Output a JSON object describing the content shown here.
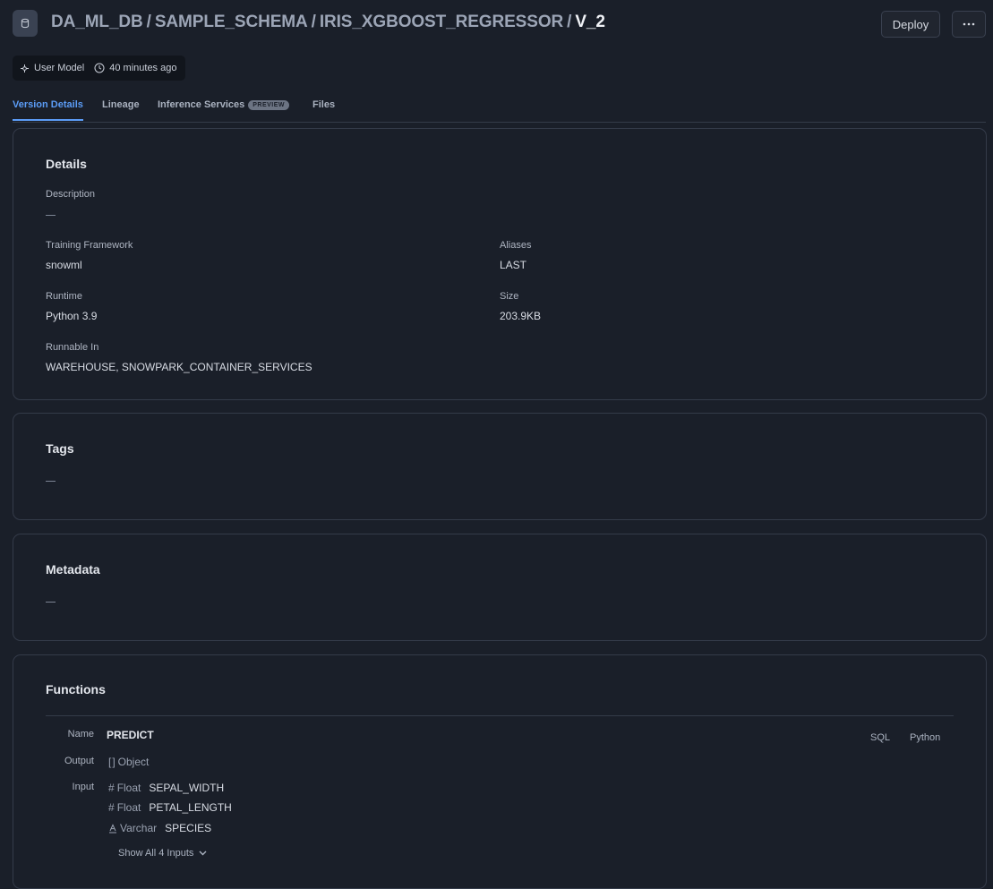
{
  "header": {
    "breadcrumbs": [
      "DA_ML_DB",
      "SAMPLE_SCHEMA",
      "IRIS_XGBOOST_REGRESSOR"
    ],
    "separator": "/",
    "current": "V_2",
    "deploy_label": "Deploy",
    "more_icon": "more-horizontal-icon",
    "db_icon": "database-icon"
  },
  "meta": {
    "type_label": "User Model",
    "type_icon": "model-icon",
    "time_label": "40 minutes ago",
    "time_icon": "clock-icon"
  },
  "tabs": [
    {
      "label": "Version Details",
      "active": true
    },
    {
      "label": "Lineage",
      "active": false
    },
    {
      "label": "Inference Services",
      "badge": "PREVIEW",
      "active": false
    },
    {
      "label": "Files",
      "active": false
    }
  ],
  "details": {
    "title": "Details",
    "description_label": "Description",
    "training_framework_label": "Training Framework",
    "training_framework_value": "snowml",
    "aliases_label": "Aliases",
    "aliases_value": "LAST",
    "runtime_label": "Runtime",
    "runtime_value": "Python 3.9",
    "size_label": "Size",
    "size_value": "203.9KB",
    "runnable_in_label": "Runnable In",
    "runnable_in_value": "WAREHOUSE, SNOWPARK_CONTAINER_SERVICES"
  },
  "tags": {
    "title": "Tags"
  },
  "metadata": {
    "title": "Metadata"
  },
  "functions": {
    "title": "Functions",
    "name_label": "Name",
    "name_value": "PREDICT",
    "output_label": "Output",
    "output_type": "Object",
    "input_label": "Input",
    "code_tabs": [
      "SQL",
      "Python"
    ],
    "inputs": [
      {
        "type": "Float",
        "name": "SEPAL_WIDTH",
        "icon": "hash-icon"
      },
      {
        "type": "Float",
        "name": "PETAL_LENGTH",
        "icon": "hash-icon"
      },
      {
        "type": "Varchar",
        "name": "SPECIES",
        "icon": "text-type-icon"
      }
    ],
    "show_all_label": "Show All 4 Inputs"
  },
  "colors": {
    "background": "#1a1f29",
    "accent": "#5b9cf6",
    "border": "#343b49"
  }
}
